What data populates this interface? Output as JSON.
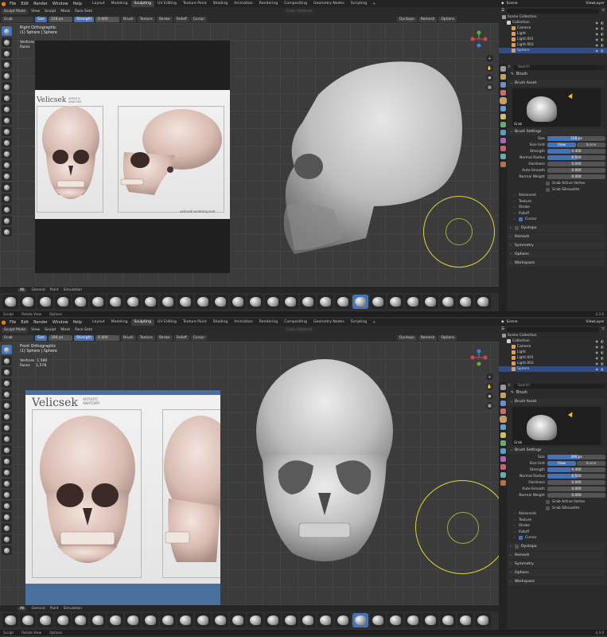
{
  "menu": {
    "items": [
      "File",
      "Edit",
      "Render",
      "Window",
      "Help"
    ],
    "workspaces": [
      "Layout",
      "Modeling",
      "Sculpting",
      "UV Editing",
      "Texture Paint",
      "Shading",
      "Animation",
      "Rendering",
      "Compositing",
      "Geometry Nodes",
      "Scripting"
    ],
    "active_workspace": "Sculpting",
    "scene": "Scene",
    "view_layer": "ViewLayer"
  },
  "header": {
    "mode": "Sculpt Mode",
    "menus": [
      "View",
      "Sculpt",
      "Mask",
      "Face Sets"
    ],
    "color_attribute": "Color Attribute",
    "dyntopo": "Dyntopo",
    "remesh": "Remesh",
    "options": "Options"
  },
  "toolrow": {
    "brush": "Grab",
    "size_label": "Size",
    "strength_label": "Strength",
    "strength": "0.400",
    "brush_menu": "Brush",
    "texture_menu": "Texture",
    "stroke_menu": "Stroke",
    "falloff_menu": "Falloff",
    "cursor_menu": "Cursor"
  },
  "panes": [
    {
      "size_value": "228 px",
      "view_name": "Right Orthographic",
      "object_line": "(1) Sphere | Sphere",
      "stats": [
        {
          "label": "Vertices",
          "value": ""
        },
        {
          "label": "Faces",
          "value": ""
        }
      ]
    },
    {
      "size_value": "306 px",
      "view_name": "Front Orthographic",
      "object_line": "(1) Sphere | Sphere",
      "stats": [
        {
          "label": "Vertices",
          "value": "1,580"
        },
        {
          "label": "Faces",
          "value": "1,578"
        }
      ]
    }
  ],
  "reference": {
    "brand": "Velicsek",
    "brand_sub_1": "ARTISTIC",
    "brand_sub_2": "ANATOMY",
    "credit": "velicsek-anatomy.com"
  },
  "shelf": {
    "tabs": [
      "All",
      "General",
      "Paint",
      "Simulation"
    ],
    "active_tab": "All"
  },
  "statusbar": {
    "items": [
      "Sculpt",
      "Rotate View",
      "Options"
    ],
    "version": "4.3.0"
  },
  "outliner": {
    "search_placeholder": "",
    "rows": [
      {
        "label": "Scene Collection",
        "depth": 0,
        "color": "#9a9a9a",
        "selected": false
      },
      {
        "label": "Collection",
        "depth": 1,
        "color": "#d0d0d0",
        "selected": false
      },
      {
        "label": "Camera",
        "depth": 2,
        "color": "#e89b4a",
        "selected": false
      },
      {
        "label": "Light",
        "depth": 2,
        "color": "#e89b4a",
        "selected": false
      },
      {
        "label": "Light.001",
        "depth": 2,
        "color": "#e89b4a",
        "selected": false
      },
      {
        "label": "Light.002",
        "depth": 2,
        "color": "#e89b4a",
        "selected": false
      },
      {
        "label": "Sphere",
        "depth": 2,
        "color": "#e89b4a",
        "selected": true
      }
    ]
  },
  "properties": {
    "search_placeholder": "Search",
    "title": "Brush",
    "brush_asset_header": "Brush Asset",
    "brush_thumb_label": "Grab",
    "brush_settings_header": "Brush Settings",
    "size_label": "Size",
    "size_unit_label": "Size Unit",
    "size_unit_options": [
      "View",
      "Scene"
    ],
    "strength_label": "Strength",
    "normal_radius_label": "Normal Radius",
    "normal_radius": "0.500",
    "hardness_label": "Hardness",
    "hardness": "0.000",
    "auto_smooth_label": "Auto-Smooth",
    "auto_smooth": "0.000",
    "normal_weight_label": "Normal Weight",
    "normal_weight": "0.000",
    "grab_active_vertex": "Grab Active Vertex",
    "grab_silhouette": "Grab Silhouette",
    "subpanels": [
      "Advanced",
      "Texture",
      "Stroke",
      "Falloff"
    ],
    "cursor_label": "Cursor",
    "dyntopo_label": "Dyntopo",
    "sections": [
      "Remesh",
      "Symmetry",
      "Options",
      "Workspace"
    ]
  }
}
